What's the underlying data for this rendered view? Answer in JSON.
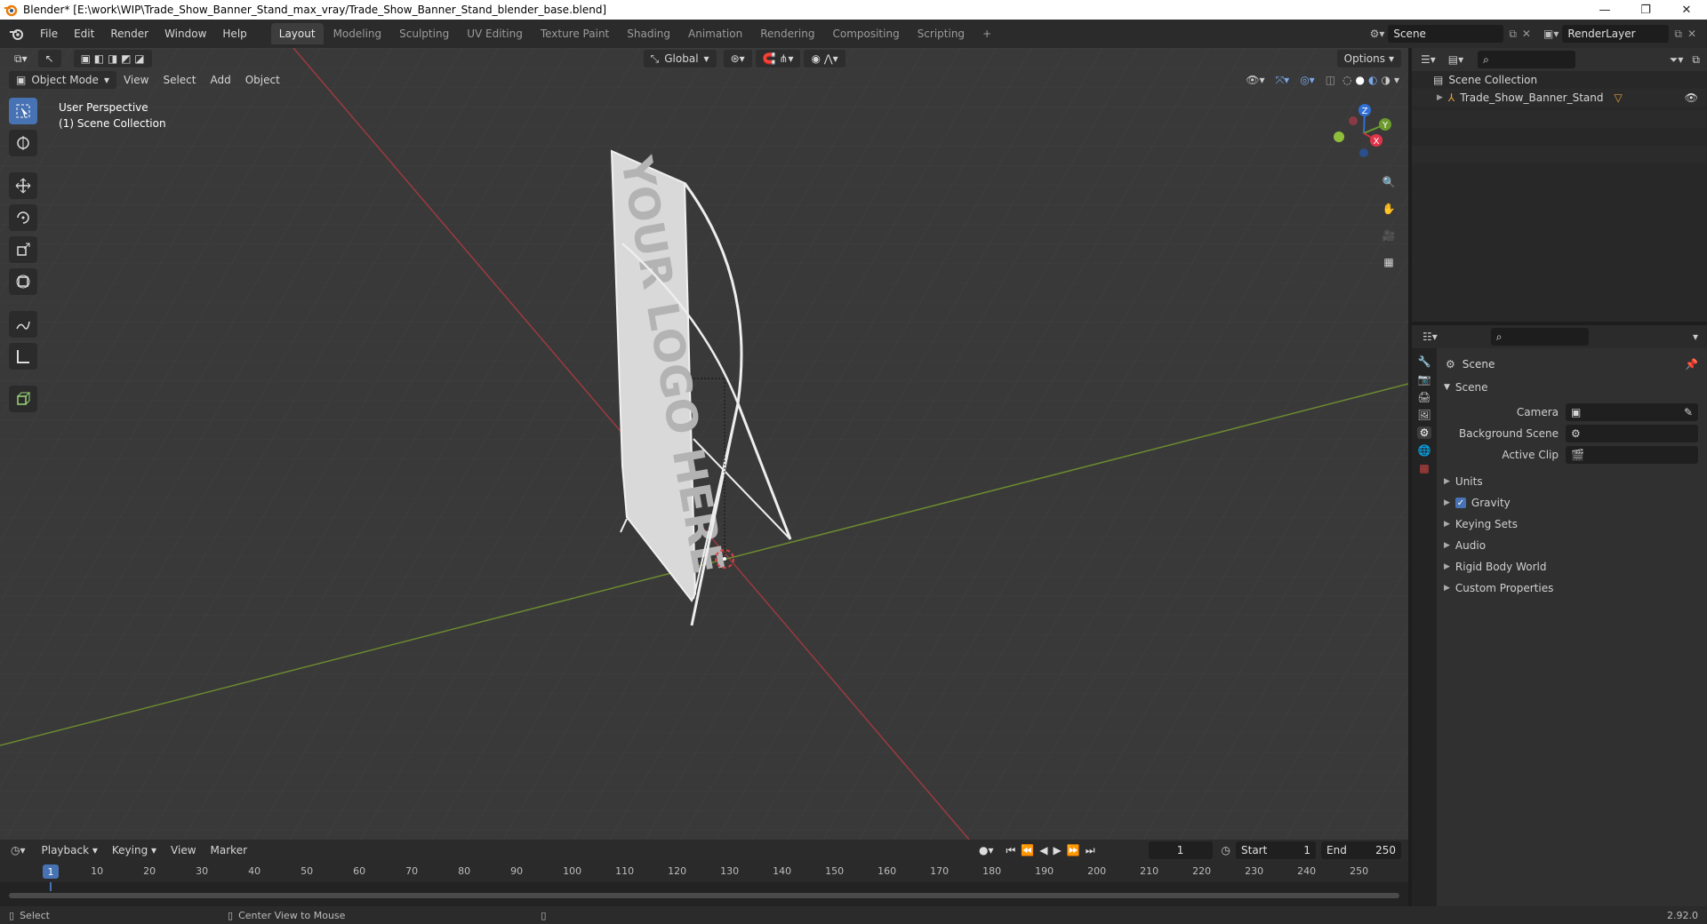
{
  "window": {
    "title": "Blender* [E:\\work\\WIP\\Trade_Show_Banner_Stand_max_vray/Trade_Show_Banner_Stand_blender_base.blend]",
    "minimize": "—",
    "restore": "❐",
    "close": "✕"
  },
  "menu": [
    "File",
    "Edit",
    "Render",
    "Window",
    "Help"
  ],
  "workspaces": [
    "Layout",
    "Modeling",
    "Sculpting",
    "UV Editing",
    "Texture Paint",
    "Shading",
    "Animation",
    "Rendering",
    "Compositing",
    "Scripting"
  ],
  "workspace_add": "+",
  "scene_selector": {
    "value": "Scene"
  },
  "render_layer": {
    "value": "RenderLayer"
  },
  "viewport": {
    "transform_orientation": "Global",
    "options_label": "Options",
    "mode": "Object Mode",
    "menus": [
      "View",
      "Select",
      "Add",
      "Object"
    ],
    "overlay_text_1": "User Perspective",
    "overlay_text_2": "(1) Scene Collection",
    "gizmo": {
      "x": "X",
      "y": "Y",
      "z": "Z"
    },
    "banner_text": "YOUR LOGO HERE"
  },
  "outliner": {
    "root": "Scene Collection",
    "items": [
      {
        "label": "Trade_Show_Banner_Stand"
      }
    ]
  },
  "properties": {
    "breadcrumb": "Scene",
    "panel_title": "Scene",
    "fields": [
      {
        "label": "Camera",
        "value": ""
      },
      {
        "label": "Background Scene",
        "value": ""
      },
      {
        "label": "Active Clip",
        "value": ""
      }
    ],
    "subpanels": [
      "Units",
      "Gravity",
      "Keying Sets",
      "Audio",
      "Rigid Body World",
      "Custom Properties"
    ],
    "gravity_checked": true
  },
  "timeline": {
    "menus": [
      "Playback",
      "Keying",
      "View",
      "Marker"
    ],
    "current_frame": "1",
    "start_label": "Start",
    "start_value": "1",
    "end_label": "End",
    "end_value": "250",
    "ruler": [
      "1",
      "10",
      "20",
      "30",
      "40",
      "50",
      "60",
      "70",
      "80",
      "90",
      "100",
      "110",
      "120",
      "130",
      "140",
      "150",
      "160",
      "170",
      "180",
      "190",
      "200",
      "210",
      "220",
      "230",
      "240",
      "250"
    ]
  },
  "status": {
    "select": "Select",
    "center_view": "Center View to Mouse",
    "version": "2.92.0"
  },
  "colors": {
    "accent": "#4772b3",
    "x_axis": "#c8323e",
    "y_axis": "#6c9a2e",
    "z_axis": "#2f6fd6",
    "viewport_bg": "#393939"
  }
}
